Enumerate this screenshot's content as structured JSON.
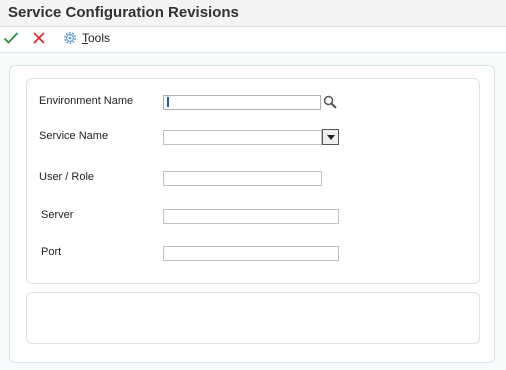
{
  "title": "Service Configuration Revisions",
  "toolbar": {
    "ok_icon": "checkmark-icon",
    "cancel_icon": "close-icon",
    "tools_icon": "gear-icon",
    "tools_label_accesskey": "T",
    "tools_label_rest": "ools"
  },
  "form": {
    "environment_name": {
      "label": "Environment Name",
      "value": "",
      "icon": "search-icon"
    },
    "service_name": {
      "label": "Service Name",
      "value": "",
      "icon": "chevron-down-icon"
    },
    "user_role": {
      "label": "User / Role",
      "value": ""
    },
    "server": {
      "label": "Server",
      "value": ""
    },
    "port": {
      "label": "Port",
      "value": ""
    }
  },
  "colors": {
    "ok_green": "#2e8b3a",
    "cancel_red": "#d9252b",
    "accent_blue": "#1a5fb4"
  }
}
